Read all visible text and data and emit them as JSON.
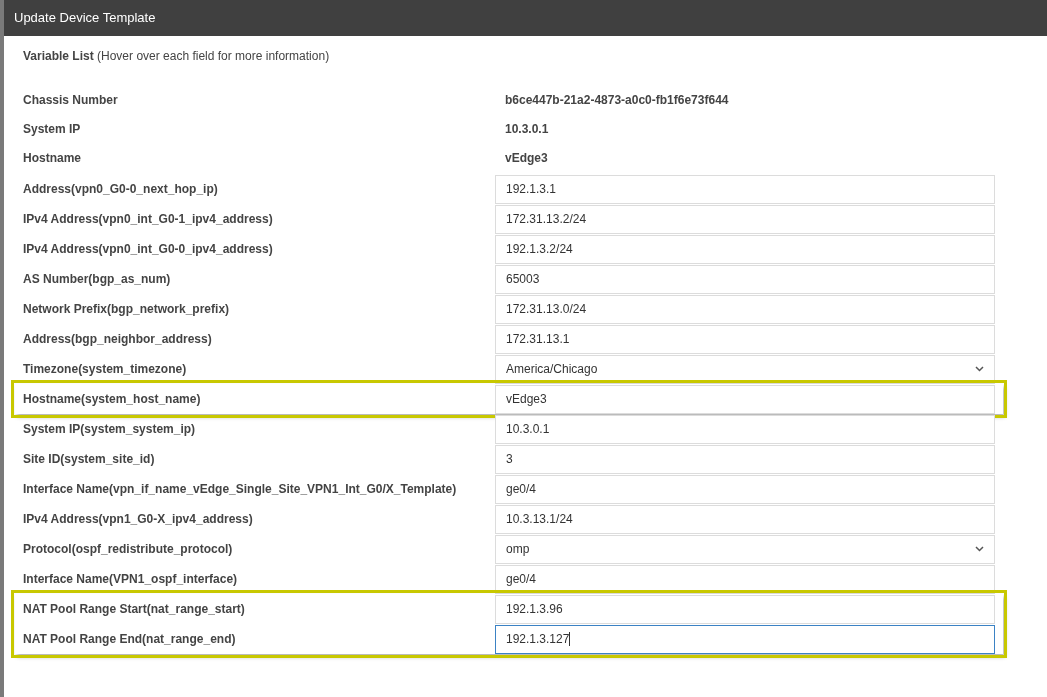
{
  "window": {
    "title": "Update Device Template"
  },
  "heading": "**Variable List** (Hover over each field for more information)",
  "info_rows": [
    {
      "label": "Chassis Number",
      "value": "b6ce447b-21a2-4873-a0c0-fb1f6e73f644"
    },
    {
      "label": "System IP",
      "value": "10.3.0.1"
    },
    {
      "label": "Hostname",
      "value": "vEdge3"
    }
  ],
  "field_groups": [
    {
      "highlighted": false,
      "fields": [
        {
          "label": "Address(vpn0_G0-0_next_hop_ip)",
          "kind": "text",
          "value": "192.1.3.1",
          "focused": false
        },
        {
          "label": "IPv4 Address(vpn0_int_G0-1_ipv4_address)",
          "kind": "text",
          "value": "172.31.13.2/24",
          "focused": false
        },
        {
          "label": "IPv4 Address(vpn0_int_G0-0_ipv4_address)",
          "kind": "text",
          "value": "192.1.3.2/24",
          "focused": false
        },
        {
          "label": "AS Number(bgp_as_num)",
          "kind": "text",
          "value": "65003",
          "focused": false
        },
        {
          "label": "Network Prefix(bgp_network_prefix)",
          "kind": "text",
          "value": "172.31.13.0/24",
          "focused": false
        },
        {
          "label": "Address(bgp_neighbor_address)",
          "kind": "text",
          "value": "172.31.13.1",
          "focused": false
        },
        {
          "label": "Timezone(system_timezone)",
          "kind": "select",
          "value": "America/Chicago",
          "focused": false
        }
      ]
    },
    {
      "highlighted": true,
      "fields": [
        {
          "label": "Hostname(system_host_name)",
          "kind": "text",
          "value": "vEdge3",
          "focused": false
        }
      ]
    },
    {
      "highlighted": false,
      "fields": [
        {
          "label": "System IP(system_system_ip)",
          "kind": "text",
          "value": "10.3.0.1",
          "focused": false
        },
        {
          "label": "Site ID(system_site_id)",
          "kind": "text",
          "value": "3",
          "focused": false
        },
        {
          "label": "Interface Name(vpn_if_name_vEdge_Single_Site_VPN1_Int_G0/X_Template)",
          "kind": "text",
          "value": "ge0/4",
          "focused": false
        },
        {
          "label": "IPv4 Address(vpn1_G0-X_ipv4_address)",
          "kind": "text",
          "value": "10.3.13.1/24",
          "focused": false
        },
        {
          "label": "Protocol(ospf_redistribute_protocol)",
          "kind": "select",
          "value": "omp",
          "focused": false
        },
        {
          "label": "Interface Name(VPN1_ospf_interface)",
          "kind": "text",
          "value": "ge0/4",
          "focused": false
        }
      ]
    },
    {
      "highlighted": true,
      "fields": [
        {
          "label": "NAT Pool Range Start(nat_range_start)",
          "kind": "text",
          "value": "192.1.3.96",
          "focused": false
        },
        {
          "label": "NAT Pool Range End(nat_range_end)",
          "kind": "text",
          "value": "192.1.3.127",
          "focused": true
        }
      ]
    }
  ]
}
